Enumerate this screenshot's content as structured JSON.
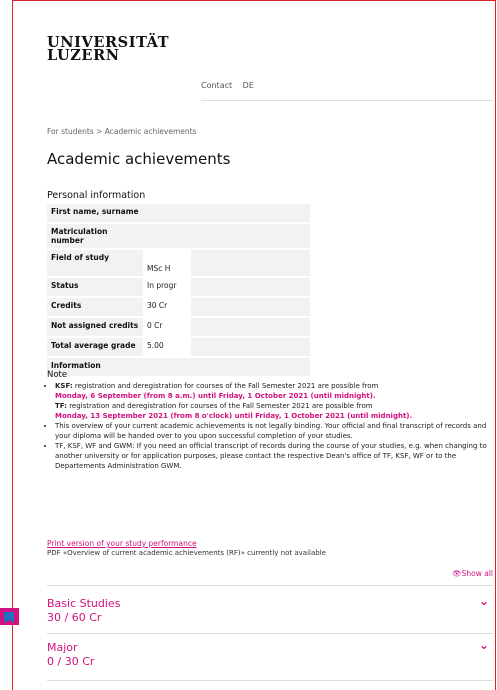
{
  "logo": {
    "line1": "UNIVERSITÄT",
    "line2": "LUZERN"
  },
  "topnav": {
    "contact": "Contact",
    "lang": "DE"
  },
  "breadcrumb": "For students > Academic achievements",
  "page_title": "Academic achievements",
  "personal": {
    "title": "Personal information",
    "rows": [
      {
        "label": "First name, surname",
        "value": ""
      },
      {
        "label": "Matriculation number",
        "value": ""
      },
      {
        "label": "Field of study",
        "value": "MSc H"
      },
      {
        "label": "Status",
        "value": "In progr"
      },
      {
        "label": "Credits",
        "value": "30 Cr"
      },
      {
        "label": "Not assigned credits",
        "value": "0 Cr"
      },
      {
        "label": "Total average grade",
        "value": "5.00"
      },
      {
        "label": "Information",
        "value": ""
      }
    ]
  },
  "note": {
    "title": "Note",
    "ksf_label": "KSF:",
    "ksf_text": " registration and deregistration for courses of the Fall Semester 2021 are possible from",
    "ksf_dates": "Monday, 6 September (from 8 a.m.) until Friday, 1 October 2021 (until midnight).",
    "tf_label": "TF:",
    "tf_text": " registration and deregistration for courses of the Fall Semester 2021 are possible from",
    "tf_dates": "Monday, 13 September 2021 (from 8 o'clock) until Friday, 1 October 2021 (until midnight).",
    "item2": "This overview of your current academic achievements is not legally binding. Your official and final transcript of records and your diploma will be handed over to you upon successful completion of your studies.",
    "item3": "TF, KSF, WF and GWM: If you need an official transcript of records during the course of your studies, e.g. when changing to another university or for application purposes, please contact the respective Dean's office of TF, KSF, WF or to the Departements Administration GWM."
  },
  "print_link": "Print version of your study performance",
  "pdf_note": "PDF «Overview of current academic achievements (RF)» currently not available",
  "show_all": "Show all",
  "sections": [
    {
      "title": "Basic Studies",
      "credits": "30 / 60 Cr"
    },
    {
      "title": "Major",
      "credits": "0 / 30 Cr"
    }
  ]
}
